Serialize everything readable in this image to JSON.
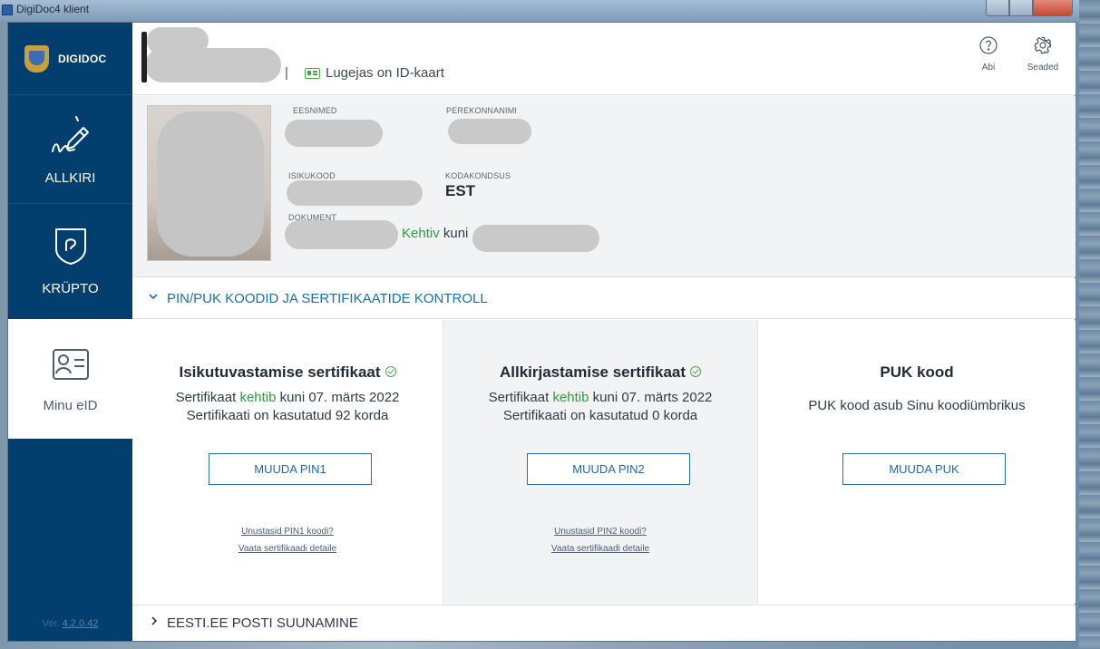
{
  "window": {
    "title": "DigiDoc4 klient"
  },
  "sidebar": {
    "logo_text": "DIGIDOC",
    "items": [
      {
        "label": "ALLKIRI",
        "icon": "signature-icon"
      },
      {
        "label": "KRÜPTO",
        "icon": "shield-lock-icon"
      },
      {
        "label": "Minu eID",
        "icon": "id-card-icon"
      }
    ],
    "version_prefix": "Ver. ",
    "version": "4.2.0.42"
  },
  "header": {
    "separator": "|",
    "reader_status": "Lugejas on ID-kaart",
    "help_label": "Abi",
    "settings_label": "Seaded"
  },
  "person": {
    "firstname_label": "EESNIMED",
    "lastname_label": "PEREKONNANIMI",
    "id_label": "ISIKUKOOD",
    "citizenship_label": "KODAKONDSUS",
    "citizenship_value": "EST",
    "document_label": "DOKUMENT",
    "valid_word": "Kehtiv",
    "valid_until": "kuni"
  },
  "pin_section": {
    "title": "PIN/PUK KOODID JA SERTIFIKAATIDE KONTROLL",
    "cards": [
      {
        "title": "Isikutuvastamise sertifikaat",
        "line1_prefix": "Sertifikaat ",
        "line1_status": "kehtib",
        "line1_suffix": " kuni 07. märts 2022",
        "line2": "Sertifikaati on kasutatud 92 korda",
        "button": "MUUDA PIN1",
        "link1": "Unustasid PIN1 koodi?",
        "link2": "Vaata sertifikaadi detaile"
      },
      {
        "title": "Allkirjastamise sertifikaat",
        "line1_prefix": "Sertifikaat ",
        "line1_status": "kehtib",
        "line1_suffix": " kuni 07. märts 2022",
        "line2": "Sertifikaati on kasutatud 0 korda",
        "button": "MUUDA PIN2",
        "link1": "Unustasid PIN2 koodi?",
        "link2": "Vaata sertifikaadi detaile"
      },
      {
        "title": "PUK kood",
        "line1": "PUK kood asub Sinu koodiümbrikus",
        "button": "MUUDA PUK"
      }
    ]
  },
  "redirect_section": {
    "title": "EESTI.EE POSTI SUUNAMINE"
  },
  "colors": {
    "sidebar": "#023e6e",
    "accent": "#1b6fb0",
    "valid": "#2e9c3c"
  }
}
